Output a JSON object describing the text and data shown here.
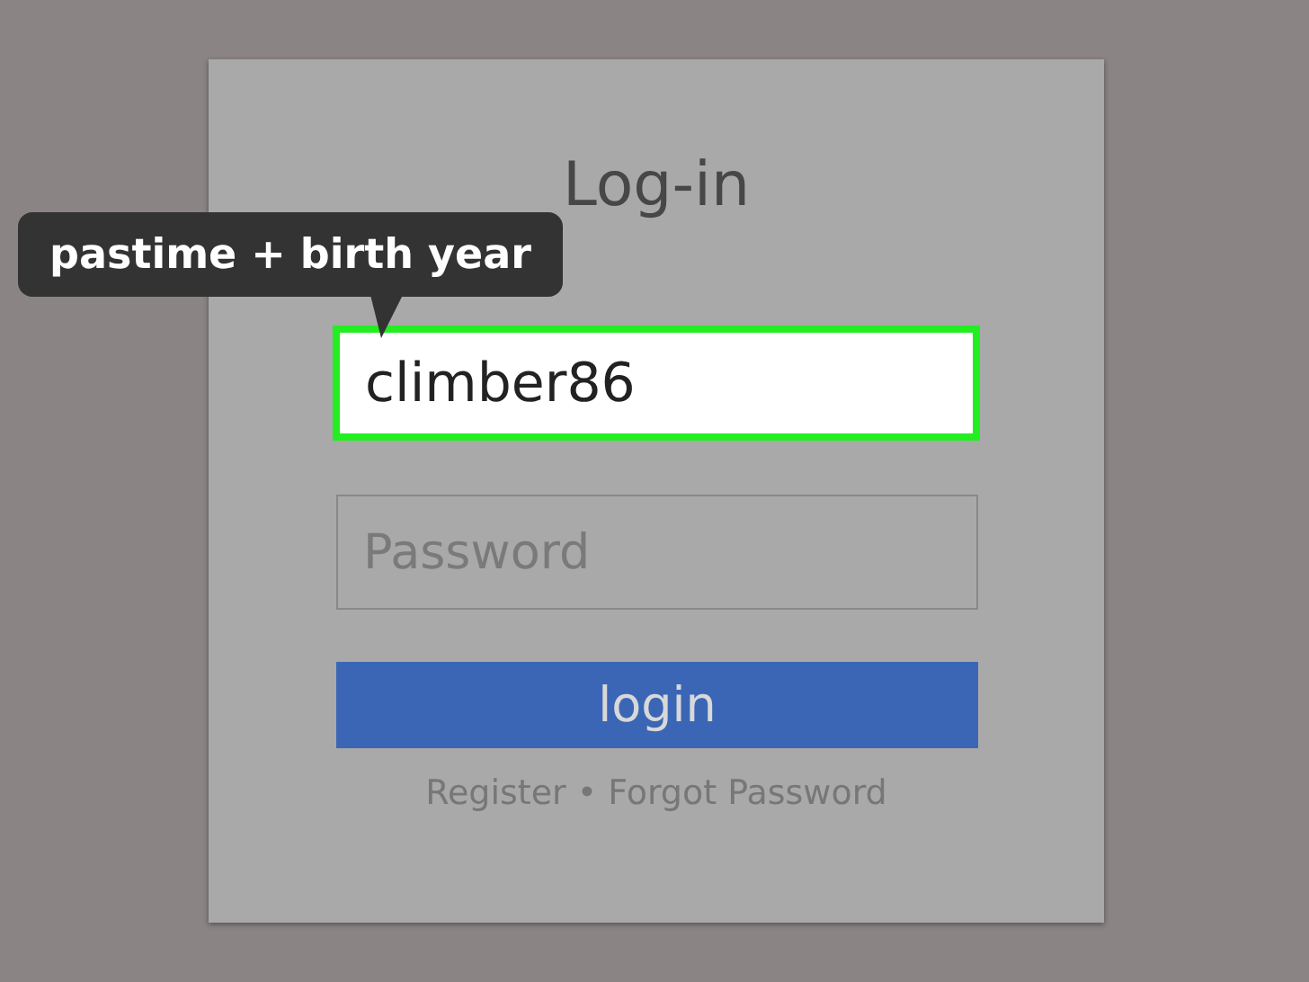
{
  "login_card": {
    "title": "Log-in",
    "username_field": {
      "value": "climber86",
      "highlighted": true
    },
    "password_field": {
      "placeholder": "Password"
    },
    "login_button": {
      "label": "login"
    },
    "links": [
      {
        "label": "Register"
      },
      {
        "label": "Forgot Password"
      }
    ],
    "link_separator": "•"
  },
  "callout": {
    "text": "pastime + birth year"
  }
}
